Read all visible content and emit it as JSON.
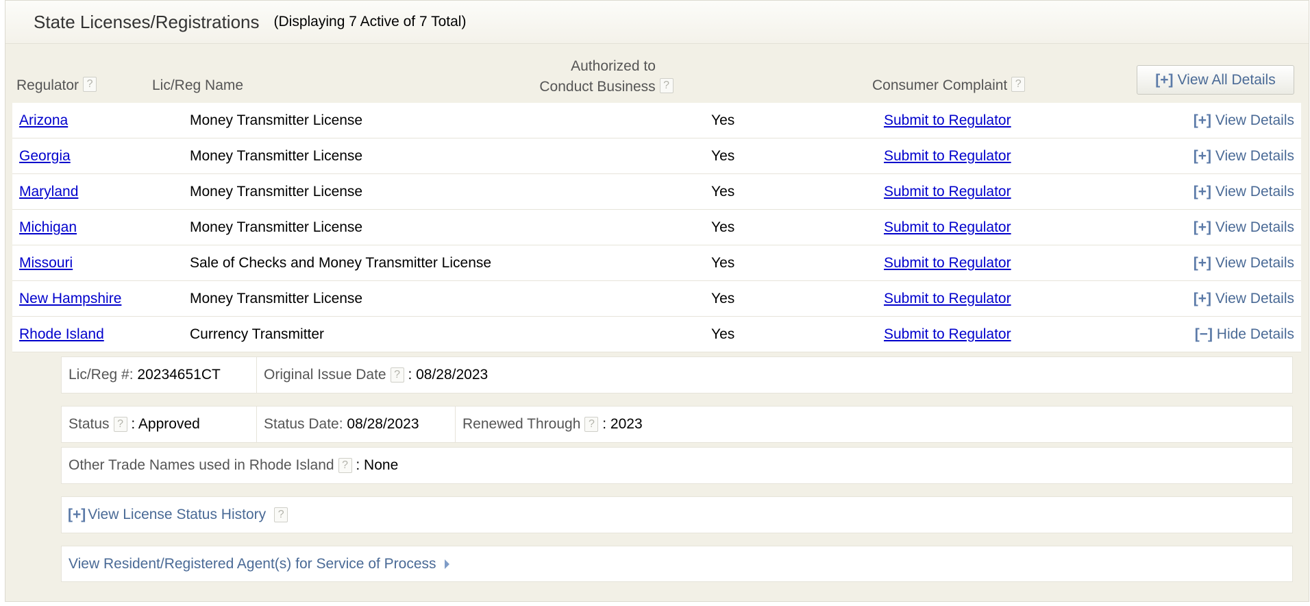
{
  "header": {
    "title": "State Licenses/Registrations",
    "subtitle": "(Displaying 7 Active of 7 Total)"
  },
  "columns": {
    "regulator": "Regulator",
    "name": "Lic/Reg Name",
    "authorized_line1": "Authorized to",
    "authorized_line2": "Conduct Business",
    "complaint": "Consumer Complaint",
    "help_glyph": "?"
  },
  "view_all": {
    "bracket": "[+]",
    "label": "View All Details"
  },
  "rows": [
    {
      "regulator": "Arizona",
      "name": "Money Transmitter License",
      "authorized": "Yes",
      "complaint": "Submit to Regulator",
      "toggle": "[+]",
      "details": "View Details"
    },
    {
      "regulator": "Georgia",
      "name": "Money Transmitter License",
      "authorized": "Yes",
      "complaint": "Submit to Regulator",
      "toggle": "[+]",
      "details": "View Details"
    },
    {
      "regulator": "Maryland",
      "name": "Money Transmitter License",
      "authorized": "Yes",
      "complaint": "Submit to Regulator",
      "toggle": "[+]",
      "details": "View Details"
    },
    {
      "regulator": "Michigan",
      "name": "Money Transmitter License",
      "authorized": "Yes",
      "complaint": "Submit to Regulator",
      "toggle": "[+]",
      "details": "View Details"
    },
    {
      "regulator": "Missouri",
      "name": "Sale of Checks and Money Transmitter License",
      "authorized": "Yes",
      "complaint": "Submit to Regulator",
      "toggle": "[+]",
      "details": "View Details"
    },
    {
      "regulator": "New Hampshire",
      "name": "Money Transmitter License",
      "authorized": "Yes",
      "complaint": "Submit to Regulator",
      "toggle": "[+]",
      "details": "View Details"
    },
    {
      "regulator": "Rhode Island",
      "name": "Currency Transmitter",
      "authorized": "Yes",
      "complaint": "Submit to Regulator",
      "toggle": "[−]",
      "details": "Hide Details"
    }
  ],
  "detail": {
    "licreg_label": "Lic/Reg #:",
    "licreg_value": "20234651CT",
    "issue_label": "Original Issue Date",
    "issue_value": ": 08/28/2023",
    "status_label": "Status",
    "status_value": ": Approved",
    "status_date_label": "Status Date:",
    "status_date_value": "08/28/2023",
    "renewed_label": "Renewed Through",
    "renewed_value": ": 2023",
    "trade_label": "Other Trade Names used in Rhode Island",
    "trade_value": ": None",
    "history_bracket": "[+]",
    "history_label": "View License Status History",
    "agents_label": "View Resident/Registered Agent(s) for Service of Process"
  }
}
